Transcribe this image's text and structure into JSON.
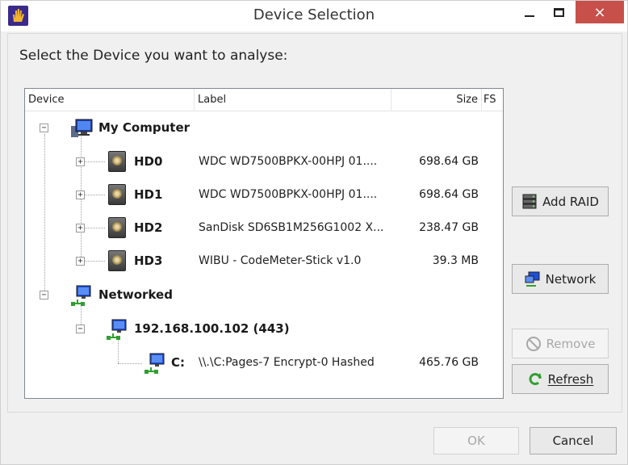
{
  "window": {
    "title": "Device Selection"
  },
  "prompt": "Select the Device you want to analyse:",
  "columns": {
    "device": "Device",
    "label": "Label",
    "size": "Size",
    "fs": "FS"
  },
  "tree": {
    "my_computer": "My Computer",
    "disks": [
      {
        "name": "HD0",
        "label": "WDC WD7500BPKX-00HPJ 01....",
        "size": "698.64 GB",
        "toggle": "+"
      },
      {
        "name": "HD1",
        "label": "WDC WD7500BPKX-00HPJ 01....",
        "size": "698.64 GB",
        "toggle": "+"
      },
      {
        "name": "HD2",
        "label": "SanDisk SD6SB1M256G1002 X...",
        "size": "238.47 GB",
        "toggle": "+"
      },
      {
        "name": "HD3",
        "label": "WIBU - CodeMeter-Stick v1.0",
        "size": "39.3 MB",
        "toggle": "+"
      }
    ],
    "networked": "Networked",
    "host": "192.168.100.102 (443)",
    "share": {
      "name": "C:",
      "label": "\\\\.\\C:Pages-7 Encrypt-0 Hashed",
      "size": "465.76 GB"
    },
    "collapse_symbol": "−"
  },
  "buttons": {
    "add_raid": "Add RAID",
    "network": "Network",
    "remove": "Remove",
    "refresh": "Refresh",
    "ok": "OK",
    "cancel": "Cancel",
    "close": "×"
  },
  "icons": {
    "app": "hand-icon",
    "computer": "computer-icon",
    "disk": "hard-disk-icon",
    "network": "network-icon"
  },
  "colors": {
    "close_button": "#c7504a",
    "app_icon": "#3b2a8a",
    "network_green": "#2fa02f",
    "network_blue": "#1e4fd6"
  }
}
